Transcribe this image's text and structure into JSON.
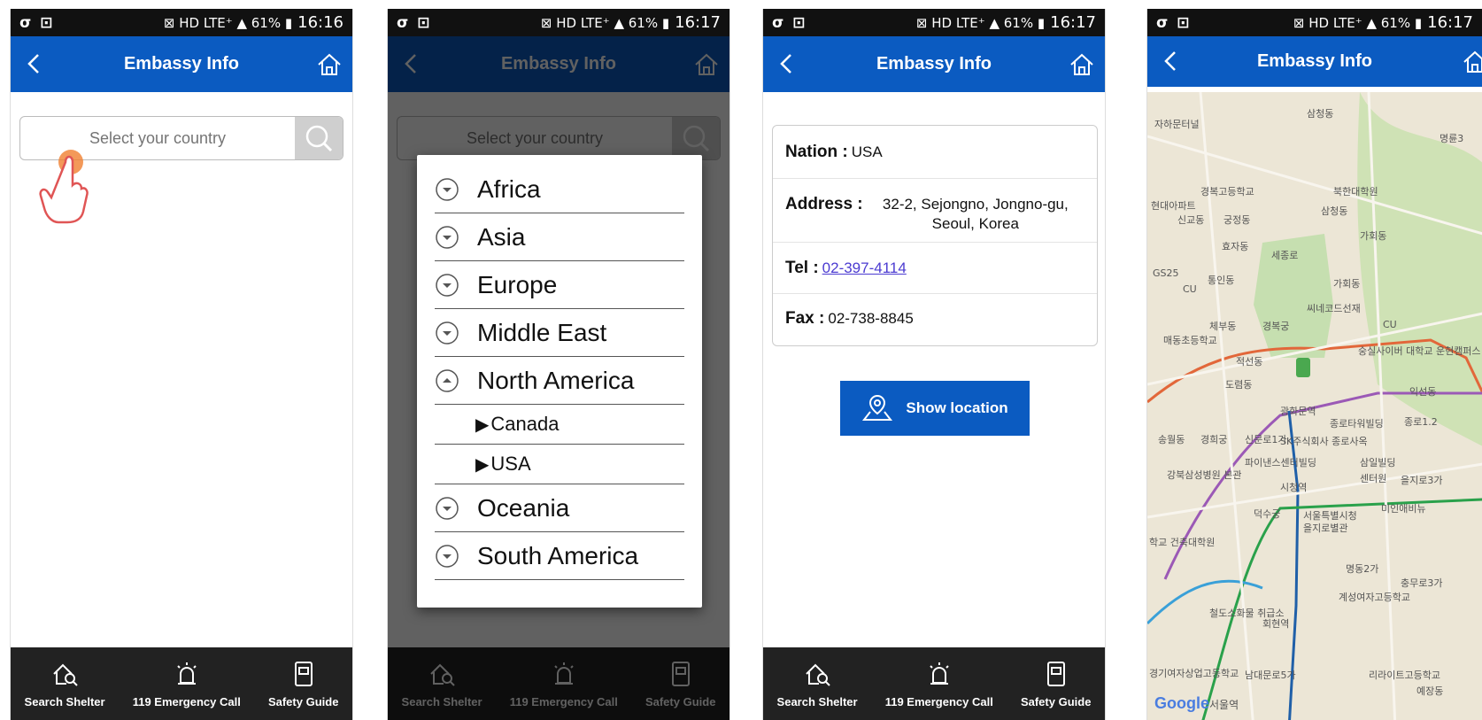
{
  "status": {
    "left_icons": [
      "σ",
      "⊡"
    ],
    "right_icons": "⊠ HD LTE⁺ ▲ 61% ▮",
    "times": [
      "16:16",
      "16:17",
      "16:17",
      "16:17"
    ]
  },
  "appbar": {
    "title": "Embassy Info"
  },
  "bottom_nav": [
    {
      "label": "Search Shelter",
      "icon": "shelter-search-icon"
    },
    {
      "label": "119 Emergency Call",
      "icon": "siren-icon"
    },
    {
      "label": "Safety Guide",
      "icon": "guide-book-icon"
    }
  ],
  "search": {
    "placeholder": "Select your country"
  },
  "dialog": {
    "regions": [
      {
        "label": "Africa",
        "state": "collapsed"
      },
      {
        "label": "Asia",
        "state": "collapsed"
      },
      {
        "label": "Europe",
        "state": "collapsed"
      },
      {
        "label": "Middle East",
        "state": "collapsed"
      },
      {
        "label": "North America",
        "state": "expanded"
      }
    ],
    "countries": [
      "Canada",
      "USA"
    ],
    "regions_after": [
      {
        "label": "Oceania",
        "state": "collapsed"
      },
      {
        "label": "South America",
        "state": "collapsed"
      }
    ]
  },
  "info": {
    "nation_label": "Nation :",
    "nation_value": "USA",
    "address_label": "Address :",
    "address_value": "32-2, Sejongno, Jongno-gu, Seoul, Korea",
    "tel_label": "Tel :",
    "tel_value": "02-397-4114",
    "fax_label": "Fax :",
    "fax_value": "02-738-8845",
    "show_location": "Show location"
  },
  "map": {
    "labels": [
      "자하문터널",
      "삼청동",
      "명륜3",
      "경복고등학교",
      "북한대학원",
      "현대아파트",
      "신교동",
      "궁정동",
      "삼청동",
      "가회동",
      "효자동",
      "세종로",
      "GS25",
      "CU",
      "통인동",
      "가회동",
      "씨네코드선재",
      "체부동",
      "경복궁",
      "CU",
      "매동초등학교",
      "숭실사이버 대학교 운현캠퍼스",
      "적선동",
      "도렴동",
      "익선동",
      "광화문역",
      "종로타워빌딩",
      "종로1.2",
      "송월동",
      "경희궁",
      "신문로1가",
      "SK주식회사 종로사옥",
      "파이낸스센터빌딩",
      "삼일빌딩",
      "강북삼성병원 본관",
      "센터원",
      "을지로3가",
      "시청역",
      "덕수궁",
      "서울특별시청",
      "을지로별관",
      "미인애비뉴",
      "학교 건축대학원",
      "명동2가",
      "충무로3가",
      "계성여자고등학교",
      "철도소화물 취급소",
      "회현역",
      "경기여자상업고등학교",
      "남대문로5가",
      "리라이트고등학교",
      "예장동"
    ],
    "google": "Google",
    "google_suffix": "서울역"
  }
}
